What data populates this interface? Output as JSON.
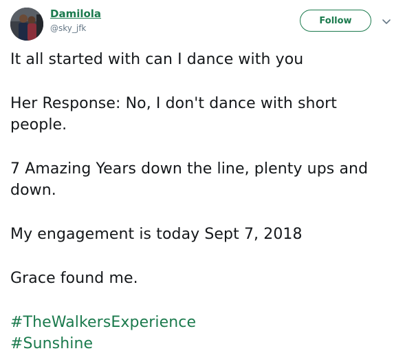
{
  "user": {
    "display_name": "Damilola",
    "handle": "@sky_jfk"
  },
  "actions": {
    "follow_label": "Follow",
    "menu_icon": "chevron-down-icon"
  },
  "tweet": {
    "paragraphs": [
      "It all started with can I dance with you",
      "Her Response: No, I don't dance with short people.",
      "7 Amazing Years down the line, plenty ups and down.",
      "My engagement is today Sept 7, 2018",
      "Grace found me."
    ],
    "hashtags": [
      "#TheWalkersExperience",
      "#Sunshine"
    ]
  },
  "colors": {
    "accent": "#1b7a4d",
    "text": "#14171a",
    "secondary": "#657786"
  }
}
